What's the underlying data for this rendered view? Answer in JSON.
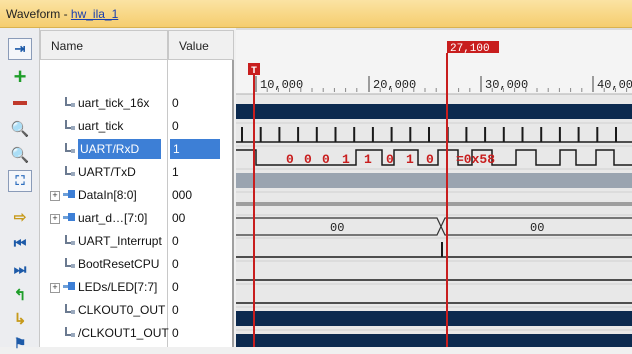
{
  "window": {
    "title_prefix": "Waveform - ",
    "title_link": "hw_ila_1"
  },
  "columns": {
    "name": "Name",
    "value": "Value"
  },
  "toolbar": {
    "icons": [
      "sidebar-toggle-icon",
      "add-icon",
      "remove-icon",
      "zoom-in-icon",
      "zoom-out-icon",
      "zoom-fit-icon",
      "goto-cursor-icon",
      "goto-start-icon",
      "goto-end-icon",
      "previous-transition-icon",
      "next-transition-icon",
      "add-marker-icon"
    ]
  },
  "signals": [
    {
      "name": "uart_tick_16x",
      "value": "0",
      "type": "bit",
      "expandable": false,
      "selected": false
    },
    {
      "name": "uart_tick",
      "value": "0",
      "type": "bit",
      "expandable": false,
      "selected": false
    },
    {
      "name": "UART/RxD",
      "value": "1",
      "type": "bit",
      "expandable": false,
      "selected": true
    },
    {
      "name": "UART/TxD",
      "value": "1",
      "type": "bit",
      "expandable": false,
      "selected": false
    },
    {
      "name": "DataIn[8:0]",
      "value": "000",
      "type": "bus",
      "expandable": true,
      "selected": false
    },
    {
      "name": "uart_d…[7:0]",
      "value": "00",
      "type": "bus",
      "expandable": true,
      "selected": false
    },
    {
      "name": "UART_Interrupt",
      "value": "0",
      "type": "bit",
      "expandable": false,
      "selected": false
    },
    {
      "name": "BootResetCPU",
      "value": "0",
      "type": "bit",
      "expandable": false,
      "selected": false
    },
    {
      "name": "LEDs/LED[7:7]",
      "value": "0",
      "type": "bus",
      "expandable": true,
      "selected": false
    },
    {
      "name": "CLKOUT0_OUT",
      "value": "0",
      "type": "bit",
      "expandable": false,
      "selected": false
    },
    {
      "name": "/CLKOUT1_OUT",
      "value": "0",
      "type": "bit",
      "expandable": false,
      "selected": false
    }
  ],
  "timeline": {
    "ticks": [
      "10,000",
      "20,000",
      "30,000",
      "40,00"
    ],
    "cursor_label": "27,100",
    "trigger_label": "T"
  },
  "annotations": {
    "rxd_bits": [
      "0",
      "0",
      "0",
      "1",
      "1",
      "0",
      "1",
      "0"
    ],
    "rxd_hex": "=0x58",
    "bus_value_left": "00",
    "bus_value_right": "00"
  },
  "colors": {
    "cursor": "#c81e1e",
    "selected_row": "#3d7fd6",
    "wave_bg": "#e8e8e8",
    "wave_dark": "#0c2a4f",
    "wave_line": "#1a1a1a",
    "title_bar": "#f5cd6e",
    "link": "#1a3fb0"
  }
}
